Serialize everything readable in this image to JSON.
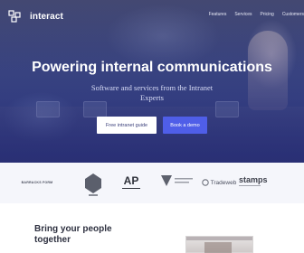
{
  "brand": {
    "name": "interact"
  },
  "nav": {
    "items": [
      "Features",
      "Services",
      "Pricing",
      "Customers"
    ]
  },
  "hero": {
    "headline": "Powering internal communications",
    "subline": "Software and services from the Intranet Experts",
    "cta_primary": "Free intranet guide",
    "cta_secondary": "Book a demo"
  },
  "logos": {
    "items": [
      "BARRACKS FORM",
      "AP",
      "Tradeweb",
      "stamps"
    ]
  },
  "section": {
    "title": "Bring your people together"
  },
  "colors": {
    "accent": "#4f5ee8",
    "hero_dark": "#2d3680",
    "logo_band": "#f5f6fb"
  }
}
